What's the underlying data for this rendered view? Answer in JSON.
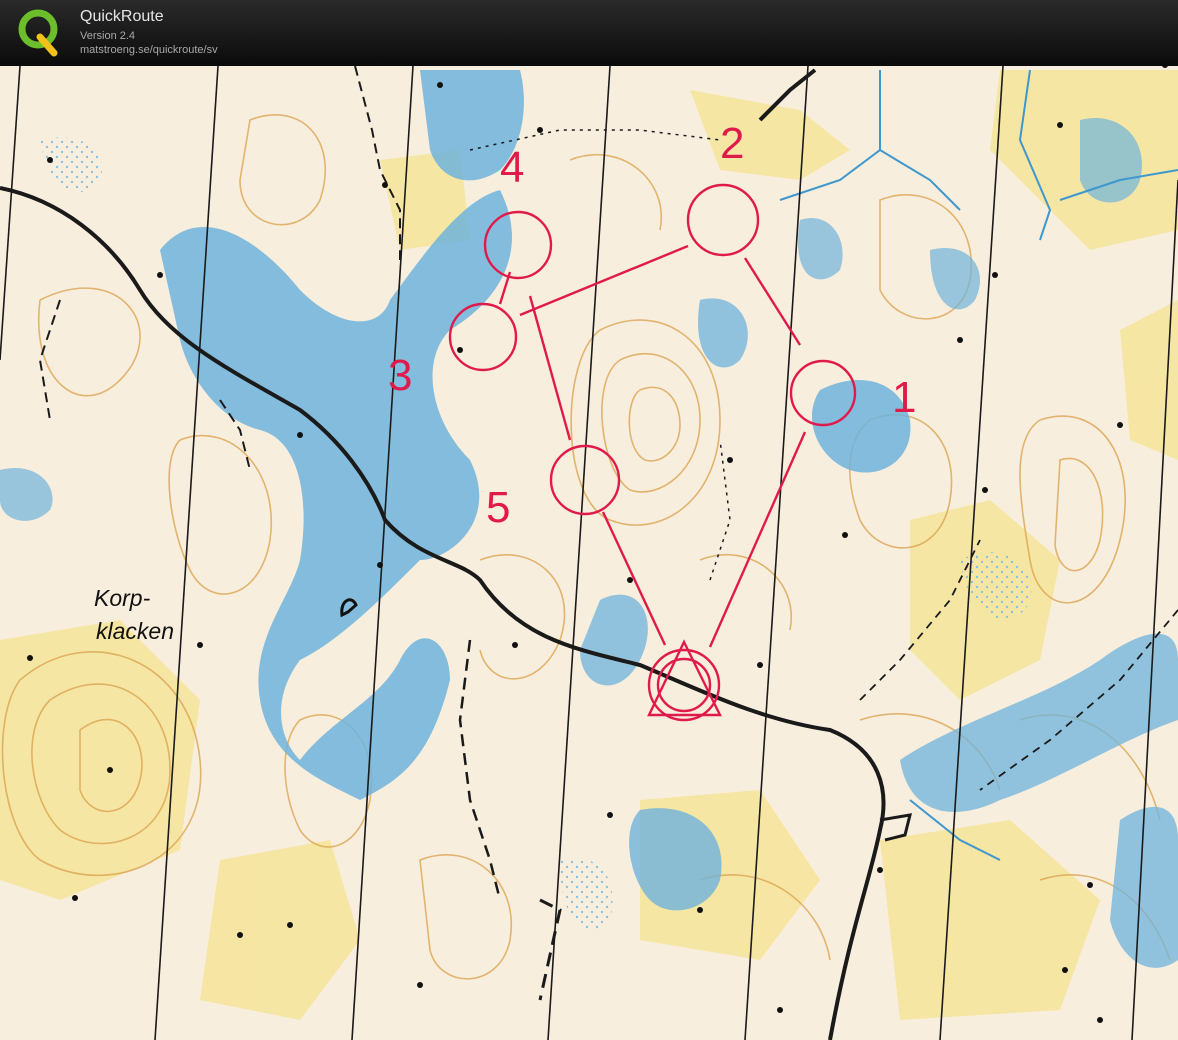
{
  "app": {
    "title": "QuickRoute",
    "version": "Version 2.4",
    "url": "matstroeng.se/quickroute/sv"
  },
  "map": {
    "place_label_line1": "Korp-",
    "place_label_line2": "klacken",
    "control_numbers": [
      "1",
      "2",
      "3",
      "4",
      "5"
    ]
  },
  "colors": {
    "course": "#e01b4c",
    "water": "#5aa9d6",
    "open_land": "#f6e6a0",
    "contour": "#d89a3c"
  }
}
